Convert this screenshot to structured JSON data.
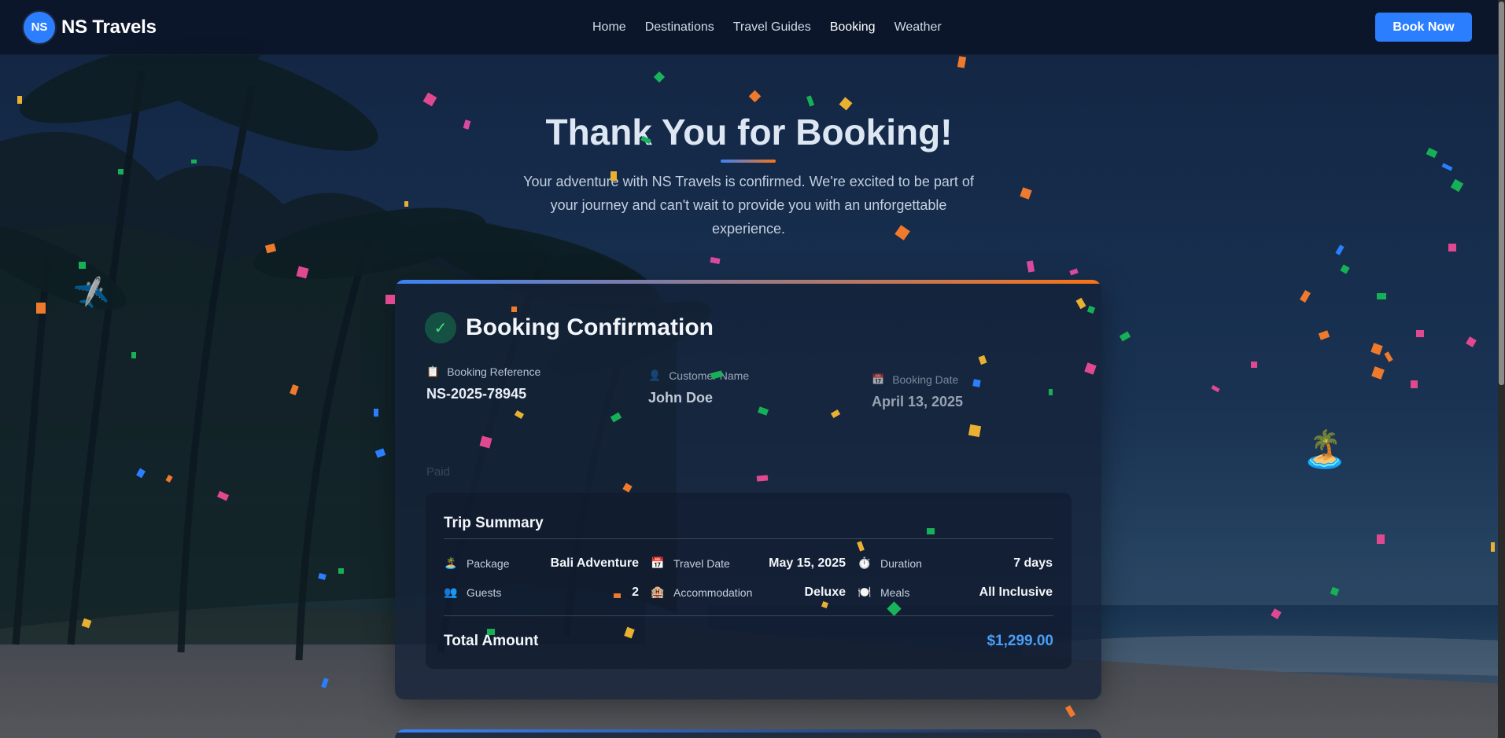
{
  "brand": {
    "logo_text": "NS",
    "name": "NS Travels"
  },
  "nav": {
    "links": [
      "Home",
      "Destinations",
      "Travel Guides",
      "Booking",
      "Weather"
    ],
    "active": "Booking",
    "cta_label": "Book Now"
  },
  "hero": {
    "title": "Thank You for Booking!",
    "subtitle": "Your adventure with NS Travels is confirmed. We're excited to be part of your journey and can't wait to provide you with an unforgettable experience."
  },
  "confirmation": {
    "title": "Booking Confirmation",
    "fields": {
      "reference": {
        "label": "Booking Reference",
        "value": "NS-2025-78945",
        "icon": "clipboard-icon"
      },
      "customer": {
        "label": "Customer Name",
        "value": "John Doe",
        "icon": "person-icon"
      },
      "date": {
        "label": "Booking Date",
        "value": "April 13, 2025",
        "icon": "calendar-icon"
      }
    },
    "payment_status": "Paid"
  },
  "trip_summary": {
    "title": "Trip Summary",
    "items": [
      {
        "icon": "🏝️",
        "label": "Package",
        "value": "Bali Adventure"
      },
      {
        "icon": "📅",
        "label": "Travel Date",
        "value": "May 15, 2025"
      },
      {
        "icon": "⏱️",
        "label": "Duration",
        "value": "7 days"
      },
      {
        "icon": "👥",
        "label": "Guests",
        "value": "2"
      },
      {
        "icon": "🏨",
        "label": "Accommodation",
        "value": "Deluxe"
      },
      {
        "icon": "🍽️",
        "label": "Meals",
        "value": "All Inclusive"
      }
    ],
    "total_label": "Total Amount",
    "total_value": "$1,299.00"
  },
  "colors": {
    "accent": "#2b7fff",
    "gradient_start": "#3b82f6",
    "gradient_end": "#f97316",
    "total": "#4a9ef5",
    "success": "#4ade80"
  }
}
